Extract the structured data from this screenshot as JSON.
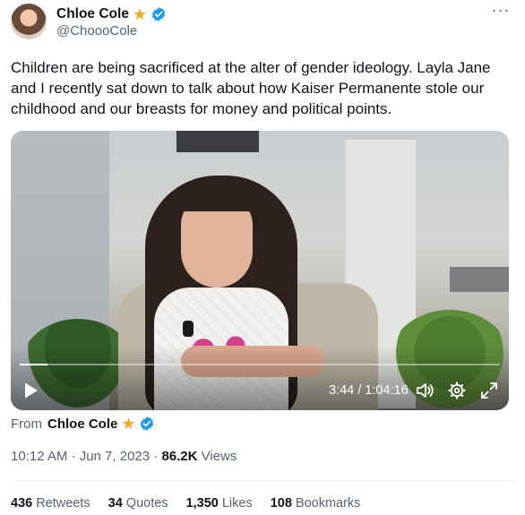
{
  "author": {
    "display_name": "Chloe Cole",
    "handle": "@ChoooCole"
  },
  "tweet": {
    "text": "Children are being sacrificed at the alter of gender ideology. Layla Jane and I recently sat down to talk about how Kaiser Permanente stole our childhood and our breasts for money and political points."
  },
  "video": {
    "time_display": "3:44 / 1:04:16",
    "progress_fraction": 0.058
  },
  "attribution": {
    "from_label": "From",
    "from_name": "Chloe Cole"
  },
  "meta": {
    "timestamp": "10:12 AM · Jun 7, 2023",
    "separator": " · ",
    "views_count": "86.2K",
    "views_label": "Views"
  },
  "stats": {
    "retweets_count": "436",
    "retweets_label": "Retweets",
    "quotes_count": "34",
    "quotes_label": "Quotes",
    "likes_count": "1,350",
    "likes_label": "Likes",
    "bookmarks_count": "108",
    "bookmarks_label": "Bookmarks"
  },
  "icons": {
    "star": "star-icon",
    "verified": "verified-badge-icon",
    "more": "more-icon",
    "play": "play-icon",
    "volume": "volume-icon",
    "settings": "settings-icon",
    "fullscreen": "fullscreen-icon"
  },
  "colors": {
    "star": "#f5a623",
    "verified": "#1d9bf0",
    "secondary_text": "#536471",
    "primary_text": "#0f1419"
  }
}
